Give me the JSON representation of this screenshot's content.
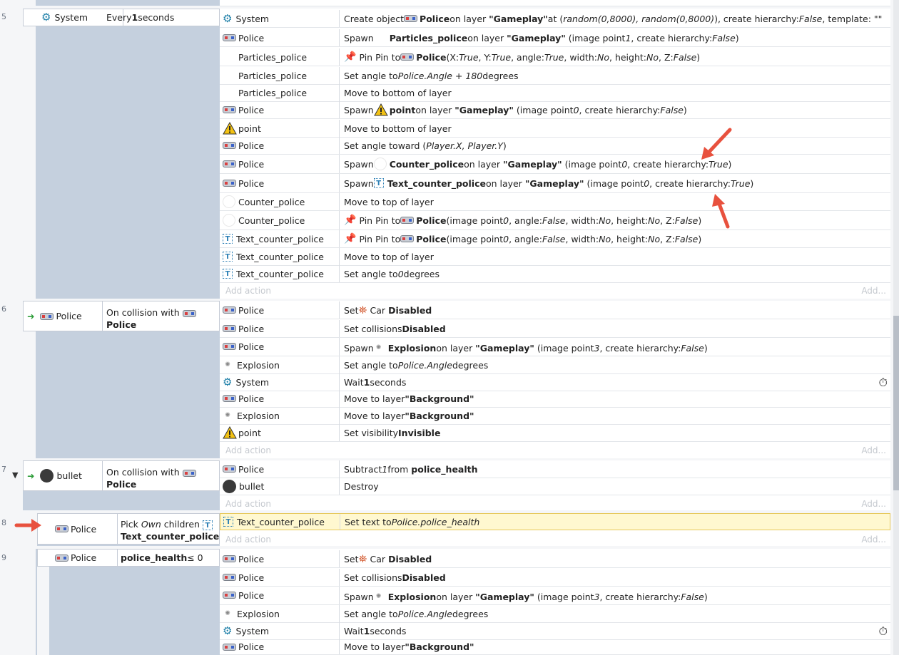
{
  "add_action": "Add action",
  "add_short": "Add...",
  "events": [
    {
      "num": "5",
      "object": "System",
      "condition_pre": "Every ",
      "condition_bold": "1",
      "condition_post": " seconds"
    },
    {
      "num": "6",
      "object": "Police",
      "condition_pre": "On collision with",
      "condition_bold": "Police"
    },
    {
      "num": "7",
      "object": "bullet",
      "condition_pre": "On collision with",
      "condition_bold": "Police"
    },
    {
      "num": "8",
      "object": "Police",
      "condition_pre": "Pick ",
      "condition_italic": "Own",
      "condition_mid": " children",
      "condition_bold": "Text_counter_police"
    },
    {
      "num": "9",
      "object": "Police",
      "condition_bold": "police_health",
      "condition_post": " ≤ 0"
    }
  ],
  "e5": [
    {
      "obj": "System",
      "icon": "gear-icon"
    },
    {
      "obj": "Police",
      "icon": "car-icon"
    },
    {
      "obj": "Particles_police",
      "icon": "particles-icon"
    },
    {
      "obj": "Particles_police",
      "icon": "particles-icon"
    },
    {
      "obj": "Particles_police",
      "icon": "particles-icon"
    },
    {
      "obj": "Police",
      "icon": "car-icon"
    },
    {
      "obj": "point",
      "icon": "warning-icon"
    },
    {
      "obj": "Police",
      "icon": "car-icon"
    },
    {
      "obj": "Police",
      "icon": "car-icon"
    },
    {
      "obj": "Police",
      "icon": "car-icon"
    },
    {
      "obj": "Counter_police",
      "icon": "white-circle-icon"
    },
    {
      "obj": "Counter_police",
      "icon": "white-circle-icon"
    },
    {
      "obj": "Text_counter_police",
      "icon": "text-object-icon"
    },
    {
      "obj": "Text_counter_police",
      "icon": "text-object-icon"
    },
    {
      "obj": "Text_counter_police",
      "icon": "text-object-icon"
    }
  ],
  "e5t": {
    "a0": [
      "Create object ",
      "Police",
      " on layer ",
      "\"Gameplay\"",
      " at (",
      "random(0,8000), random(0,8000)",
      "), create hierarchy: ",
      "False",
      ", template: \"\""
    ],
    "a1": [
      "Spawn ",
      "Particles_police",
      " on layer ",
      "\"Gameplay\"",
      " (image point ",
      "1",
      ", create hierarchy: ",
      "False",
      ")"
    ],
    "a2": [
      "Pin Pin to ",
      "Police",
      " (X: ",
      "True",
      ", Y: ",
      "True",
      ", angle: ",
      "True",
      ", width: ",
      "No",
      ", height: ",
      "No",
      ", Z: ",
      "False",
      ")"
    ],
    "a3": [
      "Set angle to ",
      "Police.Angle + 180",
      " degrees"
    ],
    "a4": [
      "Move to bottom of layer"
    ],
    "a5": [
      "Spawn ",
      "point",
      " on layer ",
      "\"Gameplay\"",
      " (image point ",
      "0",
      ", create hierarchy: ",
      "False",
      ")"
    ],
    "a6": [
      "Move to bottom of layer"
    ],
    "a7": [
      "Set angle toward (",
      "Player.X, Player.Y",
      ")"
    ],
    "a8": [
      "Spawn ",
      "Counter_police",
      " on layer ",
      "\"Gameplay\"",
      " (image point ",
      "0",
      ", create hierarchy: ",
      "True",
      ")"
    ],
    "a9": [
      "Spawn ",
      "Text_counter_police",
      " on layer ",
      "\"Gameplay\"",
      " (image point ",
      "0",
      ", create hierarchy: ",
      "True",
      ")"
    ],
    "a10": [
      "Move to top of layer"
    ],
    "a11": [
      "Pin Pin to ",
      "Police",
      " (image point ",
      "0",
      ", angle: ",
      "False",
      ", width: ",
      "No",
      ", height: ",
      "No",
      ", Z: ",
      "False",
      ")"
    ],
    "a12": [
      "Pin Pin to ",
      "Police",
      " (image point ",
      "0",
      ", angle: ",
      "False",
      ", width: ",
      "No",
      ", height: ",
      "No",
      ", Z: ",
      "False",
      ")"
    ],
    "a13": [
      "Move to top of layer"
    ],
    "a14": [
      "Set angle to ",
      "0",
      " degrees"
    ]
  },
  "e6": [
    {
      "obj": "Police",
      "t": [
        "Set ",
        "Car",
        " ",
        "Disabled"
      ]
    },
    {
      "obj": "Police",
      "t": [
        "Set collisions ",
        "Disabled"
      ]
    },
    {
      "obj": "Police",
      "t": [
        "Spawn ",
        "Explosion",
        " on layer ",
        "\"Gameplay\"",
        " (image point ",
        "3",
        ", create hierarchy: ",
        "False",
        ")"
      ]
    },
    {
      "obj": "Explosion",
      "t": [
        "Set angle to ",
        "Police.Angle",
        " degrees"
      ]
    },
    {
      "obj": "System",
      "t": [
        "Wait ",
        "1",
        " seconds"
      ]
    },
    {
      "obj": "Police",
      "t": [
        "Move to layer ",
        "\"Background\""
      ]
    },
    {
      "obj": "Explosion",
      "t": [
        "Move to layer ",
        "\"Background\""
      ]
    },
    {
      "obj": "point",
      "t": [
        "Set visibility ",
        "Invisible"
      ]
    }
  ],
  "e7": [
    {
      "obj": "Police",
      "t": [
        "Subtract ",
        "1",
        " from ",
        "police_health"
      ]
    },
    {
      "obj": "bullet",
      "t": [
        "Destroy"
      ]
    }
  ],
  "e8": [
    {
      "obj": "Text_counter_police",
      "t": [
        "Set text to ",
        "Police.police_health"
      ]
    }
  ],
  "e9": [
    {
      "obj": "Police",
      "t": [
        "Set ",
        "Car",
        " ",
        "Disabled"
      ]
    },
    {
      "obj": "Police",
      "t": [
        "Set collisions ",
        "Disabled"
      ]
    },
    {
      "obj": "Police",
      "t": [
        "Spawn ",
        "Explosion",
        " on layer ",
        "\"Gameplay\"",
        " (image point ",
        "3",
        ", create hierarchy: ",
        "False",
        ")"
      ]
    },
    {
      "obj": "Explosion",
      "t": [
        "Set angle to ",
        "Police.Angle",
        " degrees"
      ]
    },
    {
      "obj": "System",
      "t": [
        "Wait ",
        "1",
        " seconds"
      ]
    },
    {
      "obj": "Police",
      "t": [
        "Move to layer ",
        "\"Background\""
      ]
    }
  ]
}
